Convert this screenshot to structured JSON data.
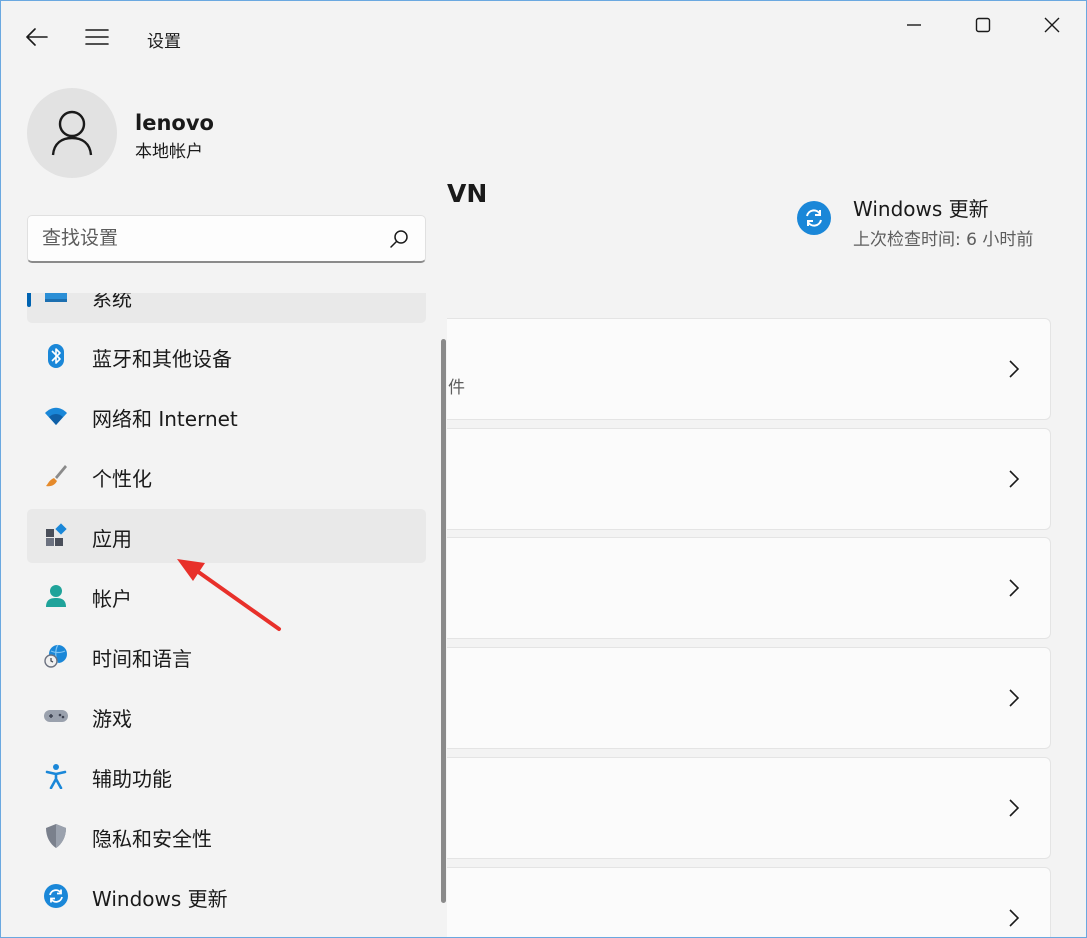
{
  "window": {
    "title": "设置"
  },
  "titlebar": {
    "back_icon": "back-arrow-icon",
    "menu_icon": "hamburger-icon",
    "controls": [
      "minimize",
      "maximize",
      "close"
    ]
  },
  "user": {
    "name": "lenovo",
    "account_type": "本地帐户"
  },
  "search": {
    "placeholder": "查找设置"
  },
  "nav": {
    "items": [
      {
        "label": "系统",
        "icon": "display-icon",
        "selected": true
      },
      {
        "label": "蓝牙和其他设备",
        "icon": "bluetooth-icon"
      },
      {
        "label": "网络和 Internet",
        "icon": "wifi-icon"
      },
      {
        "label": "个性化",
        "icon": "paintbrush-icon"
      },
      {
        "label": "应用",
        "icon": "apps-icon",
        "highlighted": true
      },
      {
        "label": "帐户",
        "icon": "person-icon"
      },
      {
        "label": "时间和语言",
        "icon": "globe-clock-icon"
      },
      {
        "label": "游戏",
        "icon": "gamepad-icon"
      },
      {
        "label": "辅助功能",
        "icon": "accessibility-icon"
      },
      {
        "label": "隐私和安全性",
        "icon": "shield-icon"
      },
      {
        "label": "Windows 更新",
        "icon": "update-icon"
      }
    ]
  },
  "main": {
    "heading_fragment": "VN",
    "windows_update": {
      "title": "Windows 更新",
      "subtitle": "上次检查时间: 6 小时前"
    },
    "cards": [
      {
        "subtitle_fragment": "件"
      },
      {
        "subtitle_fragment": ""
      },
      {
        "subtitle_fragment": ""
      },
      {
        "subtitle_fragment": ""
      },
      {
        "subtitle_fragment": ""
      },
      {
        "subtitle_fragment": ""
      }
    ]
  },
  "colors": {
    "accent": "#0063b1",
    "annotation": "#e8302a",
    "update_blue": "#1a87d8"
  }
}
